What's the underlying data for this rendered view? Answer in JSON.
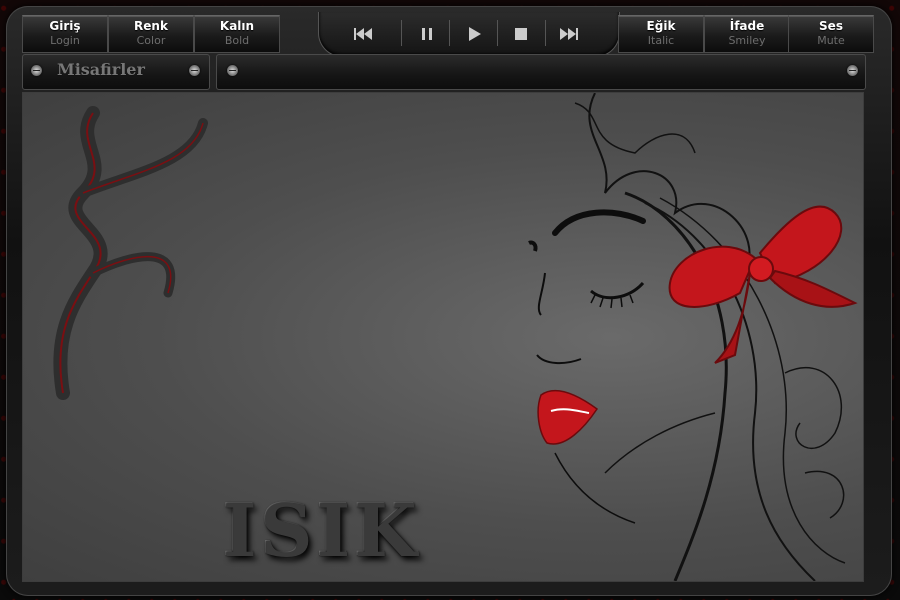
{
  "toolbar": {
    "left_buttons": [
      {
        "label": "Giriş",
        "sub": "Login"
      },
      {
        "label": "Renk",
        "sub": "Color"
      },
      {
        "label": "Kalın",
        "sub": "Bold"
      }
    ],
    "right_buttons": [
      {
        "label": "Eğik",
        "sub": "Italic"
      },
      {
        "label": "İfade",
        "sub": "Smiley"
      },
      {
        "label": "Ses",
        "sub": "Mute"
      }
    ],
    "transport": [
      "previous-icon",
      "pause-icon",
      "play-icon",
      "stop-icon",
      "next-icon"
    ]
  },
  "guests_panel": {
    "title": "Misafirler"
  },
  "stage": {
    "logo_text": "ISIK"
  },
  "colors": {
    "accent": "#c4161c",
    "frame": "#1a1a1a",
    "text": "#ffffff",
    "subtext": "#6d6d6d"
  }
}
